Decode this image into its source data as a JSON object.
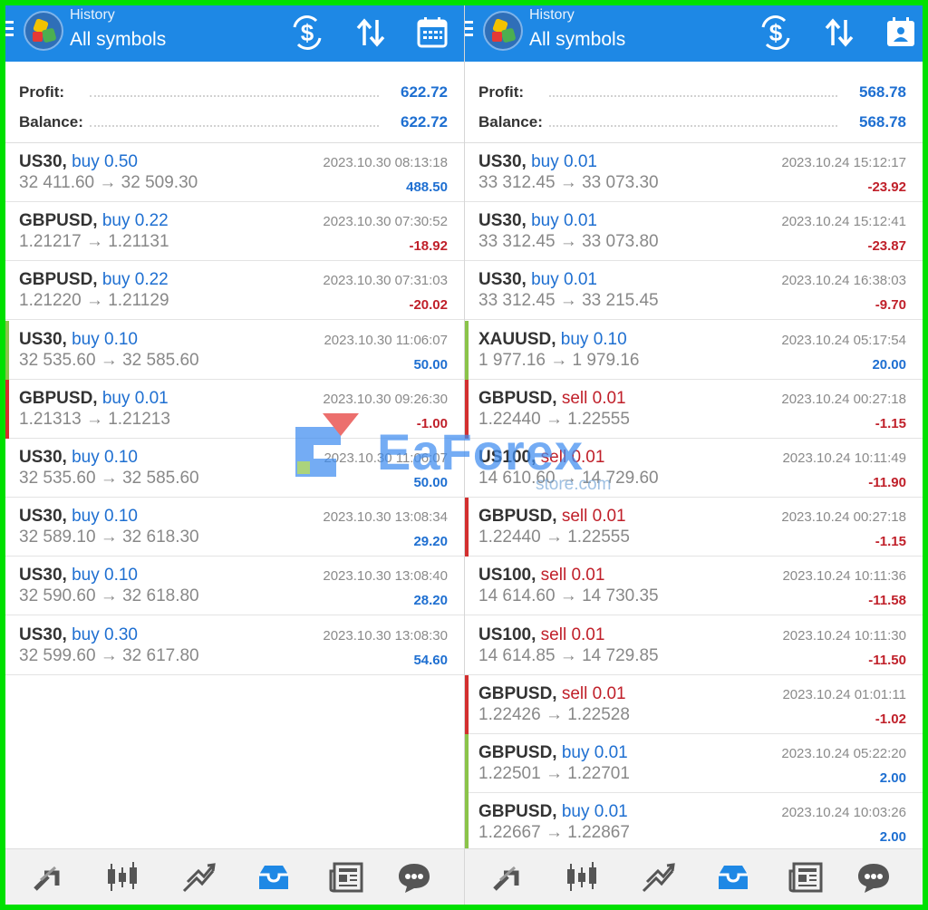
{
  "left": {
    "header": {
      "title": "History",
      "subtitle": "All symbols"
    },
    "summary": {
      "profit_label": "Profit:",
      "profit": "622.72",
      "balance_label": "Balance:",
      "balance": "622.72"
    },
    "deals": [
      {
        "symbol": "US30,",
        "type": "buy 0.50",
        "side": "buy",
        "time": "2023.10.30 08:13:18",
        "prices": "32 411.60 → 32 509.30",
        "pl": "488.50",
        "pl_sign": "pos",
        "marker": ""
      },
      {
        "symbol": "GBPUSD,",
        "type": "buy 0.22",
        "side": "buy",
        "time": "2023.10.30 07:30:52",
        "prices": "1.21217 → 1.21131",
        "pl": "-18.92",
        "pl_sign": "neg",
        "marker": ""
      },
      {
        "symbol": "GBPUSD,",
        "type": "buy 0.22",
        "side": "buy",
        "time": "2023.10.30 07:31:03",
        "prices": "1.21220 → 1.21129",
        "pl": "-20.02",
        "pl_sign": "neg",
        "marker": ""
      },
      {
        "symbol": "US30,",
        "type": "buy 0.10",
        "side": "buy",
        "time": "2023.10.30 11:06:07",
        "prices": "32 535.60 → 32 585.60",
        "pl": "50.00",
        "pl_sign": "pos",
        "marker": "#8bc34a"
      },
      {
        "symbol": "GBPUSD,",
        "type": "buy 0.01",
        "side": "buy",
        "time": "2023.10.30 09:26:30",
        "prices": "1.21313 → 1.21213",
        "pl": "-1.00",
        "pl_sign": "neg",
        "marker": "#d32f2f"
      },
      {
        "symbol": "US30,",
        "type": "buy 0.10",
        "side": "buy",
        "time": "2023.10.30 11:06:07",
        "prices": "32 535.60 → 32 585.60",
        "pl": "50.00",
        "pl_sign": "pos",
        "marker": ""
      },
      {
        "symbol": "US30,",
        "type": "buy 0.10",
        "side": "buy",
        "time": "2023.10.30 13:08:34",
        "prices": "32 589.10 → 32 618.30",
        "pl": "29.20",
        "pl_sign": "pos",
        "marker": ""
      },
      {
        "symbol": "US30,",
        "type": "buy 0.10",
        "side": "buy",
        "time": "2023.10.30 13:08:40",
        "prices": "32 590.60 → 32 618.80",
        "pl": "28.20",
        "pl_sign": "pos",
        "marker": ""
      },
      {
        "symbol": "US30,",
        "type": "buy 0.30",
        "side": "buy",
        "time": "2023.10.30 13:08:30",
        "prices": "32 599.60 → 32 617.80",
        "pl": "54.60",
        "pl_sign": "pos",
        "marker": ""
      }
    ]
  },
  "right": {
    "header": {
      "title": "History",
      "subtitle": "All symbols"
    },
    "summary": {
      "profit_label": "Profit:",
      "profit": "568.78",
      "balance_label": "Balance:",
      "balance": "568.78"
    },
    "deals": [
      {
        "symbol": "US30,",
        "type": "buy 0.01",
        "side": "buy",
        "time": "2023.10.24 15:12:17",
        "prices": "33 312.45 → 33 073.30",
        "pl": "-23.92",
        "pl_sign": "neg",
        "marker": ""
      },
      {
        "symbol": "US30,",
        "type": "buy 0.01",
        "side": "buy",
        "time": "2023.10.24 15:12:41",
        "prices": "33 312.45 → 33 073.80",
        "pl": "-23.87",
        "pl_sign": "neg",
        "marker": ""
      },
      {
        "symbol": "US30,",
        "type": "buy 0.01",
        "side": "buy",
        "time": "2023.10.24 16:38:03",
        "prices": "33 312.45 → 33 215.45",
        "pl": "-9.70",
        "pl_sign": "neg",
        "marker": ""
      },
      {
        "symbol": "XAUUSD,",
        "type": "buy 0.10",
        "side": "buy",
        "time": "2023.10.24 05:17:54",
        "prices": "1 977.16 → 1 979.16",
        "pl": "20.00",
        "pl_sign": "pos",
        "marker": "#8bc34a"
      },
      {
        "symbol": "GBPUSD,",
        "type": "sell 0.01",
        "side": "sell",
        "time": "2023.10.24 00:27:18",
        "prices": "1.22440 → 1.22555",
        "pl": "-1.15",
        "pl_sign": "neg",
        "marker": "#d32f2f"
      },
      {
        "symbol": "US100,",
        "type": "sell 0.01",
        "side": "sell",
        "time": "2023.10.24 10:11:49",
        "prices": "14 610.60 → 14 729.60",
        "pl": "-11.90",
        "pl_sign": "neg",
        "marker": ""
      },
      {
        "symbol": "GBPUSD,",
        "type": "sell 0.01",
        "side": "sell",
        "time": "2023.10.24 00:27:18",
        "prices": "1.22440 → 1.22555",
        "pl": "-1.15",
        "pl_sign": "neg",
        "marker": "#d32f2f"
      },
      {
        "symbol": "US100,",
        "type": "sell 0.01",
        "side": "sell",
        "time": "2023.10.24 10:11:36",
        "prices": "14 614.60 → 14 730.35",
        "pl": "-11.58",
        "pl_sign": "neg",
        "marker": ""
      },
      {
        "symbol": "US100,",
        "type": "sell 0.01",
        "side": "sell",
        "time": "2023.10.24 10:11:30",
        "prices": "14 614.85 → 14 729.85",
        "pl": "-11.50",
        "pl_sign": "neg",
        "marker": ""
      },
      {
        "symbol": "GBPUSD,",
        "type": "sell 0.01",
        "side": "sell",
        "time": "2023.10.24 01:01:11",
        "prices": "1.22426 → 1.22528",
        "pl": "-1.02",
        "pl_sign": "neg",
        "marker": "#d32f2f"
      },
      {
        "symbol": "GBPUSD,",
        "type": "buy 0.01",
        "side": "buy",
        "time": "2023.10.24 05:22:20",
        "prices": "1.22501 → 1.22701",
        "pl": "2.00",
        "pl_sign": "pos",
        "marker": "#8bc34a"
      },
      {
        "symbol": "GBPUSD,",
        "type": "buy 0.01",
        "side": "buy",
        "time": "2023.10.24 10:03:26",
        "prices": "1.22667 → 1.22867",
        "pl": "2.00",
        "pl_sign": "pos",
        "marker": "#8bc34a"
      }
    ]
  },
  "bottom_nav": [
    "quotes-icon",
    "chart-icon",
    "trade-icon",
    "history-icon",
    "news-icon",
    "chat-icon"
  ],
  "watermark": {
    "brand": "EaForex",
    "sub": "store.com"
  },
  "colors": {
    "header": "#1e88e5",
    "buy": "#1e6fd1",
    "sell": "#c0202a",
    "frame": "#00e000",
    "active_tab": "#1e88e5"
  }
}
